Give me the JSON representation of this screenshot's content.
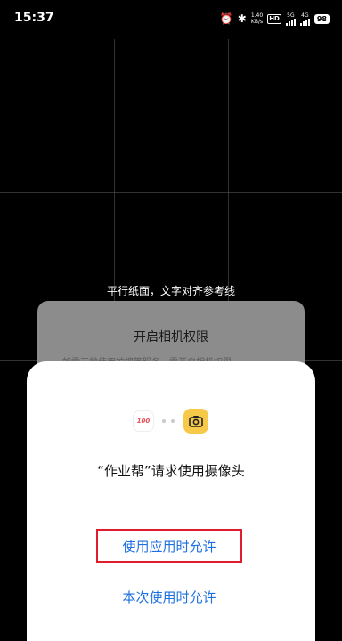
{
  "status_bar": {
    "time": "15:37",
    "net_speed_value": "1.40",
    "net_speed_unit": "KB/s",
    "hd_label": "HD",
    "sim1_label": "5G",
    "sim2_label": "4G",
    "battery": "98"
  },
  "camera": {
    "hint": "平行纸面，文字对齐参考线"
  },
  "permission_card": {
    "title": "开启相机权限",
    "description": "如需正常使用拍搜等服务，需开启相机权限"
  },
  "sheet": {
    "app_logo_text": "100",
    "question": "“作业帮”请求使用摄像头",
    "allow_while_using": "使用应用时允许",
    "allow_once": "本次使用时允许"
  },
  "colors": {
    "accent_blue": "#1e6fe0",
    "highlight_red": "#e21c2d",
    "camera_icon_yellow": "#f7c948"
  }
}
